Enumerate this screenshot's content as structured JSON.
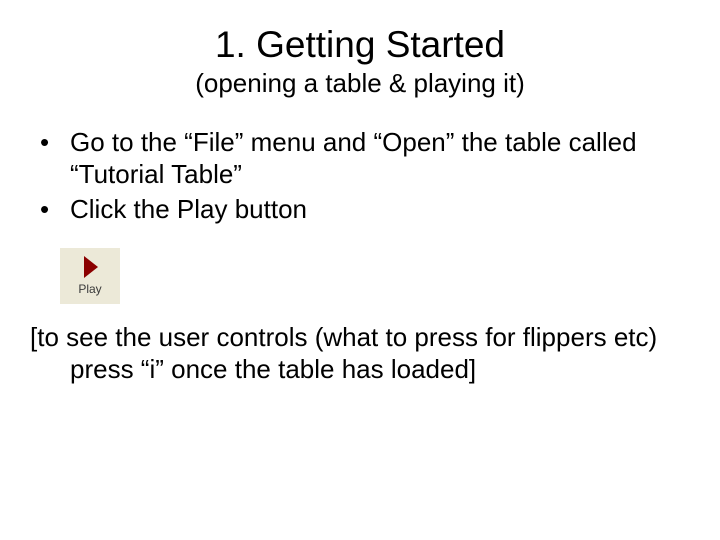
{
  "title": "1. Getting Started",
  "subtitle": "(opening a table & playing it)",
  "bullets": [
    "Go to the “File” menu and “Open” the table called “Tutorial Table”",
    "Click the Play button"
  ],
  "play_button": {
    "label": "Play",
    "icon_color": "#8b0000"
  },
  "note": "[to see the user controls (what to press for flippers etc) press “i” once the table has loaded]"
}
